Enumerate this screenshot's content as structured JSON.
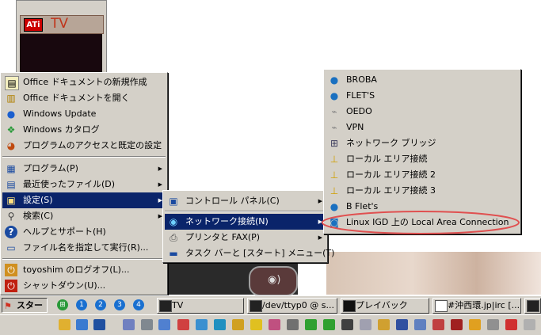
{
  "desktop": {
    "tv_widget": {
      "brand": "ATi",
      "title": "TV"
    }
  },
  "start_menu": {
    "items": [
      {
        "label": "Office ドキュメントの新規作成",
        "icon": "office-new-icon"
      },
      {
        "label": "Office ドキュメントを開く",
        "icon": "office-open-icon"
      },
      {
        "label": "Windows Update",
        "icon": "windows-update-icon"
      },
      {
        "label": "Windows カタログ",
        "icon": "windows-catalog-icon"
      },
      {
        "label": "プログラムのアクセスと既定の設定",
        "icon": "program-access-icon"
      },
      {
        "label": "プログラム(P)",
        "icon": "programs-icon"
      },
      {
        "label": "最近使ったファイル(D)",
        "icon": "documents-icon"
      },
      {
        "label": "設定(S)",
        "icon": "settings-icon"
      },
      {
        "label": "検索(C)",
        "icon": "search-icon"
      },
      {
        "label": "ヘルプとサポート(H)",
        "icon": "help-icon"
      },
      {
        "label": "ファイル名を指定して実行(R)...",
        "icon": "run-icon"
      },
      {
        "label": "toyoshim のログオフ(L)...",
        "icon": "logoff-icon"
      },
      {
        "label": "シャットダウン(U)...",
        "icon": "shutdown-icon"
      }
    ]
  },
  "settings_menu": {
    "items": [
      {
        "label": "コントロール パネル(C)",
        "icon": "control-panel-icon"
      },
      {
        "label": "ネットワーク接続(N)",
        "icon": "network-connections-icon"
      },
      {
        "label": "プリンタと FAX(P)",
        "icon": "printer-icon"
      },
      {
        "label": "タスク バーと [スタート] メニュー(T)",
        "icon": "taskbar-icon"
      }
    ]
  },
  "network_menu": {
    "items": [
      {
        "label": "BROBA",
        "icon": "globe-icon"
      },
      {
        "label": "FLET'S",
        "icon": "globe-icon"
      },
      {
        "label": "OEDO",
        "icon": "dialup-icon"
      },
      {
        "label": "VPN",
        "icon": "dialup-icon"
      },
      {
        "label": "ネットワーク ブリッジ",
        "icon": "bridge-icon"
      },
      {
        "label": "ローカル エリア接続",
        "icon": "lan-icon"
      },
      {
        "label": "ローカル エリア接続 2",
        "icon": "lan-icon"
      },
      {
        "label": "ローカル エリア接続 3",
        "icon": "lan-icon"
      },
      {
        "label": "B Flet's",
        "icon": "globe-icon"
      },
      {
        "label": "Linux IGD 上の Local Area Connection",
        "icon": "igd-icon"
      }
    ],
    "highlight_color": "#e05050"
  },
  "taskbar": {
    "start_label": "スタート",
    "quick_launch": [
      "⊞",
      "1",
      "2",
      "3",
      "4"
    ],
    "buttons": [
      {
        "label": "TV"
      },
      {
        "label": "/dev/ttyp0 @ s..."
      },
      {
        "label": "プレイバック"
      },
      {
        "label": "#沖西環.jp|irc [..."
      },
      {
        "label": ""
      }
    ]
  },
  "colors": {
    "menu_bg": "#d4d0c8",
    "selection": "#0a246a",
    "taskbar_bg": "#d4d0c8"
  }
}
